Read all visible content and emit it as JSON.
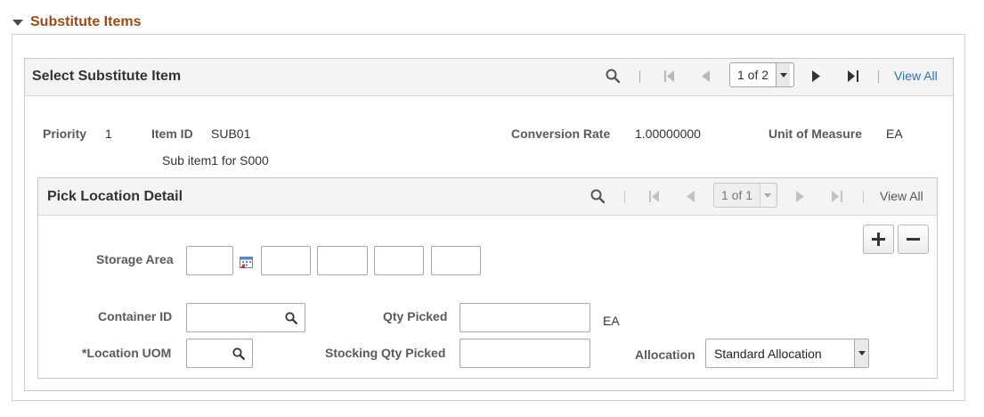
{
  "section": {
    "title": "Substitute Items"
  },
  "grid": {
    "title": "Select Substitute Item",
    "pager": "1 of 2",
    "view_all": "View All"
  },
  "item": {
    "priority_label": "Priority",
    "priority_value": "1",
    "item_id_label": "Item ID",
    "item_id_value": "SUB01",
    "description": "Sub item1 for S000",
    "conversion_label": "Conversion Rate",
    "conversion_value": "1.00000000",
    "uom_label": "Unit of Measure",
    "uom_value": "EA"
  },
  "pick_location": {
    "title": "Pick Location Detail",
    "pager": "1 of 1",
    "view_all": "View All",
    "storage_area_label": "Storage Area",
    "container_id_label": "Container ID",
    "location_uom_label": "*Location UOM",
    "qty_picked_label": "Qty Picked",
    "qty_picked_unit": "EA",
    "stocking_qty_label": "Stocking Qty Picked",
    "allocation_label": "Allocation",
    "allocation_value": "Standard Allocation"
  },
  "colors": {
    "section_title": "#9a4a13",
    "link": "#2f6fb8",
    "header_bg": "#f4f4f4"
  },
  "icons": [
    "collapse-triangle-icon",
    "search-icon",
    "first-page-icon",
    "previous-icon",
    "next-icon",
    "last-page-icon",
    "dropdown-arrow-icon",
    "calendar-icon",
    "add-icon",
    "remove-icon"
  ]
}
